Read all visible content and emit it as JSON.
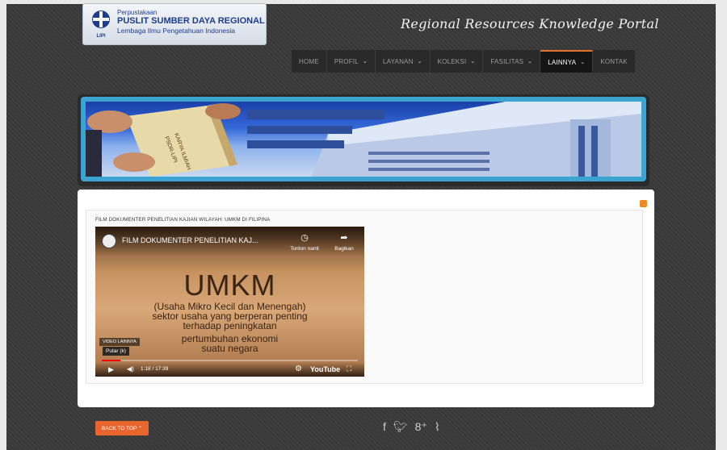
{
  "header": {
    "logo_line1": "Perpustakaan",
    "logo_line2": "PUSLIT SUMBER DAYA REGIONAL",
    "logo_line3": "Lembaga Ilmu Pengetahuan Indonesia",
    "logo_emblem_text": "LIPI",
    "site_title": "Regional Resources Knowledge Portal"
  },
  "nav": {
    "items": [
      {
        "label": "HOME",
        "dropdown": false
      },
      {
        "label": "PROFIL",
        "dropdown": true
      },
      {
        "label": "LAYANAN",
        "dropdown": true
      },
      {
        "label": "KOLEKSI",
        "dropdown": true
      },
      {
        "label": "FASILITAS",
        "dropdown": true
      },
      {
        "label": "LAINNYA",
        "dropdown": true,
        "active": true
      },
      {
        "label": "KONTAK",
        "dropdown": false
      }
    ],
    "dropdown_glyph": "⌄"
  },
  "banner": {
    "book_text": "KARYA ILMIAH PSDR-LIPI"
  },
  "article": {
    "title": "FILM DOKUMENTER PENELITIAN KAJIAN WILAYAH: UMKM DI FILIPINA"
  },
  "video": {
    "title": "FILM DOKUMENTER PENELITIAN KAJ...",
    "watch_later": "Tonton nanti",
    "share": "Bagikan",
    "headline": "UMKM",
    "line1": "(Usaha Mikro Kecil dan Menengah)",
    "line2": "sektor usaha yang berperan penting",
    "line3": "terhadap peningkatan",
    "line4": "pertumbuhan ekonomi",
    "line5": "suatu negara",
    "more_videos": "VIDEO LAINNYA",
    "tooltip": "Putar (k)",
    "time": "1:18 / 17:39",
    "brand": "YouTube",
    "progress_fraction": 0.074
  },
  "footer": {
    "back_to_top": "BACK TO TOP ⌃",
    "social": [
      "facebook-icon",
      "twitter-icon",
      "google-plus-icon",
      "rss-icon"
    ]
  }
}
